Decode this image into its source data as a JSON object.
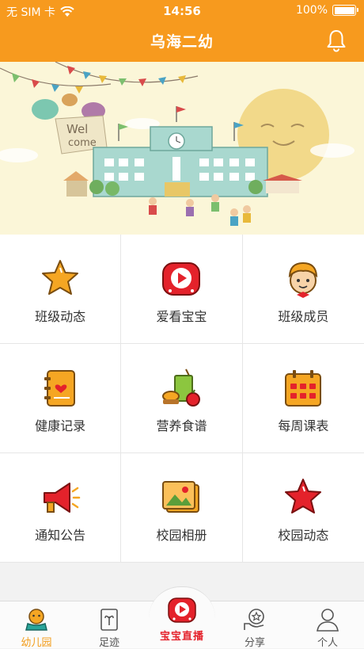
{
  "status_bar": {
    "carrier": "无 SIM 卡",
    "time": "14:56",
    "battery": "100%"
  },
  "header": {
    "title": "乌海二幼",
    "notification_icon": "bell-icon"
  },
  "banner": {
    "sign_text": [
      "Wel",
      "come"
    ]
  },
  "grid": [
    {
      "label": "班级动态",
      "icon": "star-icon"
    },
    {
      "label": "爱看宝宝",
      "icon": "video-play-icon"
    },
    {
      "label": "班级成员",
      "icon": "child-face-icon"
    },
    {
      "label": "健康记录",
      "icon": "health-notebook-icon"
    },
    {
      "label": "营养食谱",
      "icon": "food-icon"
    },
    {
      "label": "每周课表",
      "icon": "calendar-icon"
    },
    {
      "label": "通知公告",
      "icon": "megaphone-icon"
    },
    {
      "label": "校园相册",
      "icon": "photo-album-icon"
    },
    {
      "label": "校园动态",
      "icon": "red-star-icon"
    }
  ],
  "tabbar": {
    "tabs": [
      {
        "label": "幼儿园",
        "icon": "kindergarten-icon",
        "active": true
      },
      {
        "label": "足迹",
        "icon": "footprint-icon",
        "active": false
      },
      {
        "label": "宝宝直播",
        "icon": "live-tv-icon",
        "active": false
      },
      {
        "label": "分享",
        "icon": "share-icon",
        "active": false
      },
      {
        "label": "个人",
        "icon": "person-icon",
        "active": false
      }
    ]
  },
  "colors": {
    "accent": "#f79a1e",
    "live_red": "#e4222b"
  }
}
